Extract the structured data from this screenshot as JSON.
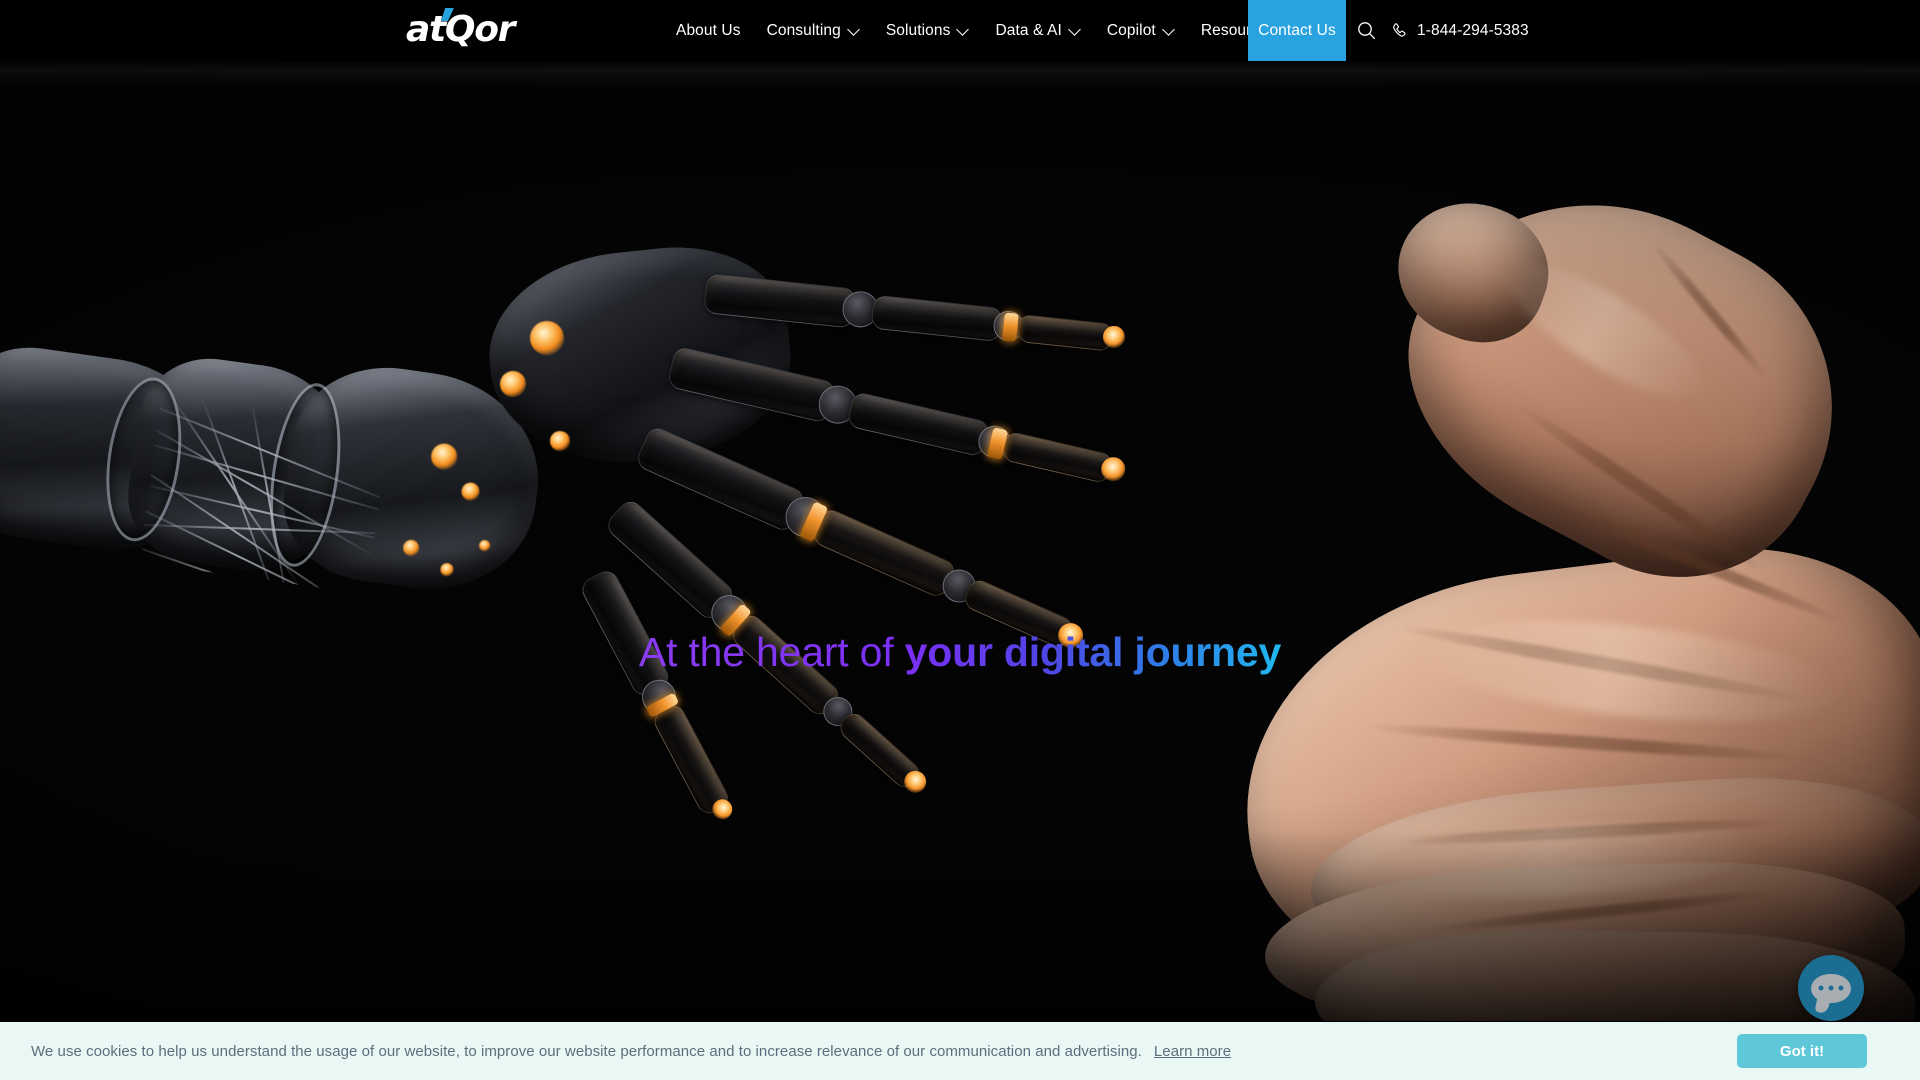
{
  "brand": {
    "name": "atQor",
    "accent_color": "#29a3e0"
  },
  "header": {
    "nav_items": [
      {
        "label": "About Us",
        "has_dropdown": false
      },
      {
        "label": "Consulting",
        "has_dropdown": true
      },
      {
        "label": "Solutions",
        "has_dropdown": true
      },
      {
        "label": "Data & AI",
        "has_dropdown": true
      },
      {
        "label": "Copilot",
        "has_dropdown": true
      },
      {
        "label": "Resources",
        "has_dropdown": true
      }
    ],
    "contact_button": "Contact Us",
    "search_icon": "search-icon",
    "phone_icon": "phone-icon",
    "phone_number": "1-844-294-5383",
    "background_color": "#000000"
  },
  "hero": {
    "title_light": "At the heart of ",
    "title_bold": "your digital journey",
    "gradient_start": "#8b3bf0",
    "gradient_end": "#22b8f0",
    "image_description": "Robotic hand reaching toward an open human palm on a black background"
  },
  "chat": {
    "icon": "chat-bubble-icon",
    "color": "#1b6e92"
  },
  "cookie": {
    "message": "We use cookies to help us understand the usage of our website, to improve our website performance and to increase relevance of our communication and advertising.",
    "learn_more": "Learn more",
    "accept_label": "Got it!",
    "background_color": "#e9f7f5",
    "button_color": "#5fc8d8"
  }
}
